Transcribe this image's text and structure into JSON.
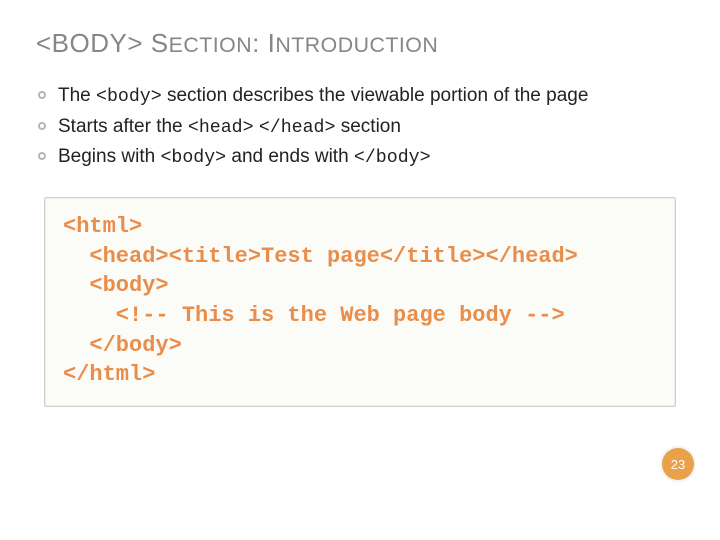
{
  "title": "<BODY> Section: Introduction",
  "bullets": [
    {
      "pre": "The ",
      "code1": "<body>",
      "post1": " section describes the viewable portion of the page"
    },
    {
      "pre": "Starts after the ",
      "code1": "<head>",
      "mid": " ",
      "code2": "</head>",
      "post1": " section"
    },
    {
      "pre": "Begins with ",
      "code1": "<body>",
      "mid": " and ends with ",
      "code2": "</body>",
      "post1": ""
    }
  ],
  "code_lines": [
    "<html>",
    "  <head><title>Test page</title></head>",
    "  <body>",
    "    <!-- This is the Web page body -->",
    "  </body>",
    "</html>"
  ],
  "page_number": "23"
}
